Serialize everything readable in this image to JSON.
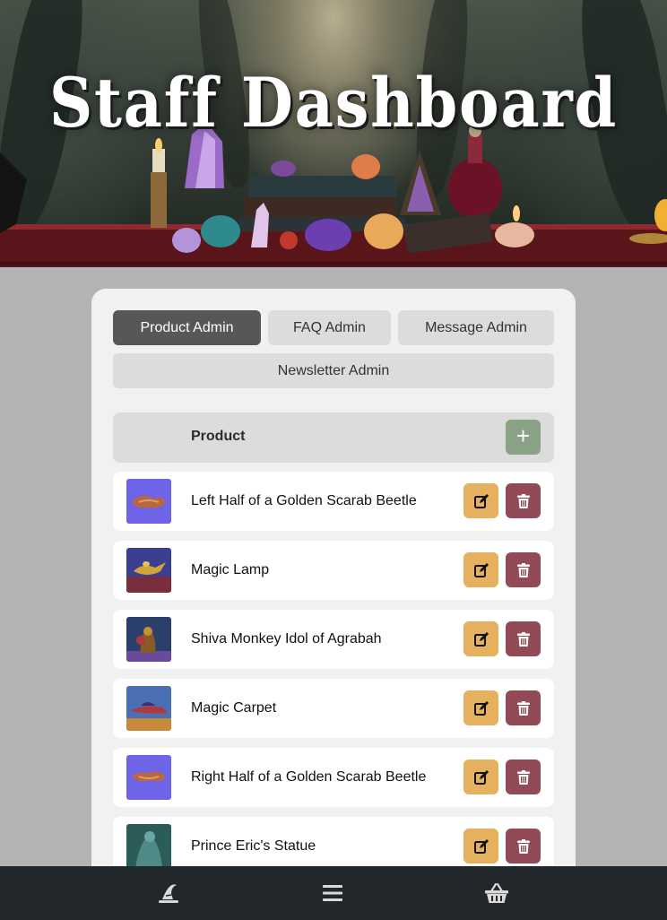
{
  "header": {
    "title": "Staff Dashboard"
  },
  "tabs": [
    {
      "label": "Product Admin",
      "active": true
    },
    {
      "label": "FAQ Admin",
      "active": false
    },
    {
      "label": "Message Admin",
      "active": false
    },
    {
      "label": "Newsletter Admin",
      "active": false
    }
  ],
  "table": {
    "column_title": "Product",
    "add_label": "+",
    "add_icon": "plus-icon",
    "edit_icon": "edit-icon",
    "delete_icon": "trash-icon",
    "products": [
      {
        "name": "Left Half of a Golden Scarab Beetle",
        "thumb": "scarab-left"
      },
      {
        "name": "Magic Lamp",
        "thumb": "lamp"
      },
      {
        "name": "Shiva Monkey Idol of Agrabah",
        "thumb": "idol"
      },
      {
        "name": "Magic Carpet",
        "thumb": "carpet"
      },
      {
        "name": "Right Half of a Golden Scarab Beetle",
        "thumb": "scarab-right"
      },
      {
        "name": "Prince Eric's Statue",
        "thumb": "statue"
      }
    ]
  },
  "bottom_nav": [
    {
      "icon": "witch-hat-icon"
    },
    {
      "icon": "menu-icon"
    },
    {
      "icon": "basket-icon"
    }
  ],
  "colors": {
    "active_tab": "#575757",
    "add_button": "#8aa286",
    "edit_button": "#e5b15f",
    "delete_button": "#924a56",
    "nav_background": "#22272b",
    "page_background": "#b3b3b3"
  }
}
